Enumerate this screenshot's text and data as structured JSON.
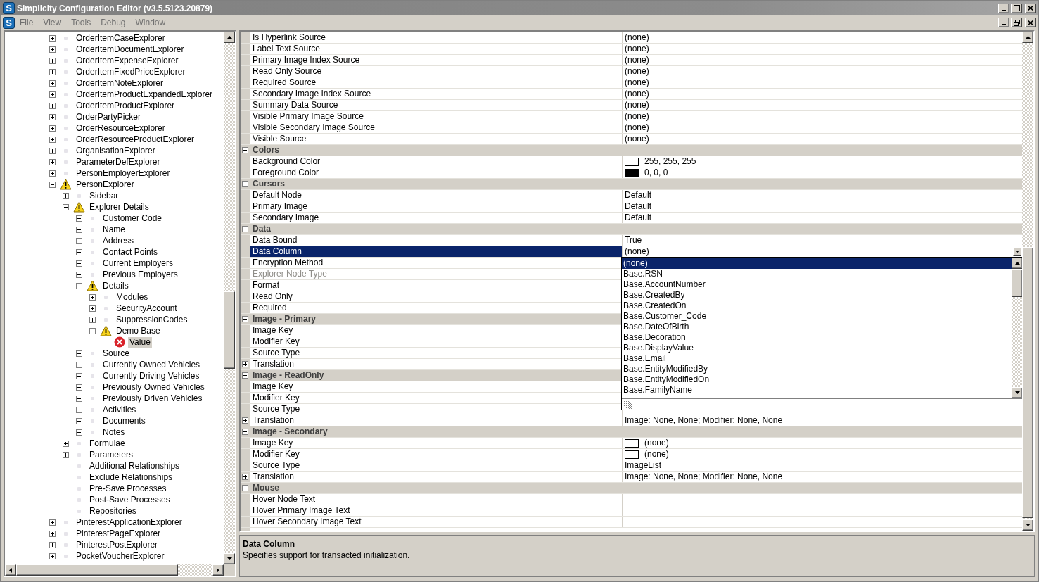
{
  "window": {
    "title": "Simplicity Configuration Editor (v3.5.5123.20879)",
    "logo": "S"
  },
  "menu": {
    "logo": "S",
    "items": [
      "File",
      "View",
      "Tools",
      "Debug",
      "Window"
    ]
  },
  "tree": {
    "nodes": [
      {
        "label": "OrderItemCaseExplorer",
        "expanded": false,
        "kind": "item",
        "selected": false
      },
      {
        "label": "OrderItemDocumentExplorer",
        "expanded": false,
        "kind": "item",
        "selected": false
      },
      {
        "label": "OrderItemExpenseExplorer",
        "expanded": false,
        "kind": "item",
        "selected": false
      },
      {
        "label": "OrderItemFixedPriceExplorer",
        "expanded": false,
        "kind": "item",
        "selected": false
      },
      {
        "label": "OrderItemNoteExplorer",
        "expanded": false,
        "kind": "item",
        "selected": false
      },
      {
        "label": "OrderItemProductExpandedExplorer",
        "expanded": false,
        "kind": "item",
        "selected": false
      },
      {
        "label": "OrderItemProductExplorer",
        "expanded": false,
        "kind": "item",
        "selected": false
      },
      {
        "label": "OrderPartyPicker",
        "expanded": false,
        "kind": "item",
        "selected": false
      },
      {
        "label": "OrderResourceExplorer",
        "expanded": false,
        "kind": "item",
        "selected": false
      },
      {
        "label": "OrderResourceProductExplorer",
        "expanded": false,
        "kind": "item",
        "selected": false
      },
      {
        "label": "OrganisationExplorer",
        "expanded": false,
        "kind": "item",
        "selected": false
      },
      {
        "label": "ParameterDefExplorer",
        "expanded": false,
        "kind": "item",
        "selected": false
      },
      {
        "label": "PersonEmployerExplorer",
        "expanded": false,
        "kind": "item",
        "selected": false
      },
      {
        "label": "PersonExplorer",
        "expanded": true,
        "kind": "warning",
        "selected": false,
        "children": [
          {
            "label": "Sidebar",
            "expanded": false,
            "kind": "item",
            "selected": false
          },
          {
            "label": "Explorer Details",
            "expanded": true,
            "kind": "warning",
            "selected": false,
            "children": [
              {
                "label": "Customer Code",
                "expanded": false,
                "kind": "item",
                "selected": false
              },
              {
                "label": "Name",
                "expanded": false,
                "kind": "item",
                "selected": false
              },
              {
                "label": "Address",
                "expanded": false,
                "kind": "item",
                "selected": false
              },
              {
                "label": "Contact Points",
                "expanded": false,
                "kind": "item",
                "selected": false
              },
              {
                "label": "Current Employers",
                "expanded": false,
                "kind": "item",
                "selected": false
              },
              {
                "label": "Previous Employers",
                "expanded": false,
                "kind": "item",
                "selected": false
              },
              {
                "label": "Details",
                "expanded": true,
                "kind": "warning",
                "selected": false,
                "children": [
                  {
                    "label": "Modules",
                    "expanded": false,
                    "kind": "item",
                    "selected": false
                  },
                  {
                    "label": "SecurityAccount",
                    "expanded": false,
                    "kind": "item",
                    "selected": false
                  },
                  {
                    "label": "SuppressionCodes",
                    "expanded": false,
                    "kind": "item",
                    "selected": false
                  },
                  {
                    "label": "Demo Base",
                    "expanded": true,
                    "kind": "warning",
                    "selected": false,
                    "children": [
                      {
                        "label": "Value",
                        "kind": "error",
                        "selected": true
                      }
                    ]
                  }
                ]
              },
              {
                "label": "Source",
                "expanded": false,
                "kind": "item",
                "selected": false
              },
              {
                "label": "Currently Owned Vehicles",
                "expanded": false,
                "kind": "item",
                "selected": false
              },
              {
                "label": "Currently Driving Vehicles",
                "expanded": false,
                "kind": "item",
                "selected": false
              },
              {
                "label": "Previously Owned Vehicles",
                "expanded": false,
                "kind": "item",
                "selected": false
              },
              {
                "label": "Previously Driven Vehicles",
                "expanded": false,
                "kind": "item",
                "selected": false
              },
              {
                "label": "Activities",
                "expanded": false,
                "kind": "item",
                "selected": false
              },
              {
                "label": "Documents",
                "expanded": false,
                "kind": "item",
                "selected": false
              },
              {
                "label": "Notes",
                "expanded": false,
                "kind": "item",
                "selected": false
              }
            ]
          },
          {
            "label": "Formulae",
            "expanded": false,
            "kind": "item",
            "selected": false
          },
          {
            "label": "Parameters",
            "expanded": false,
            "kind": "item",
            "selected": false
          },
          {
            "label": "Additional Relationships",
            "kind": "item",
            "selected": false
          },
          {
            "label": "Exclude Relationships",
            "kind": "item",
            "selected": false
          },
          {
            "label": "Pre-Save Processes",
            "kind": "item",
            "selected": false
          },
          {
            "label": "Post-Save Processes",
            "kind": "item",
            "selected": false
          },
          {
            "label": "Repositories",
            "kind": "item",
            "selected": false
          }
        ]
      },
      {
        "label": "PinterestApplicationExplorer",
        "expanded": false,
        "kind": "item",
        "selected": false
      },
      {
        "label": "PinterestPageExplorer",
        "expanded": false,
        "kind": "item",
        "selected": false
      },
      {
        "label": "PinterestPostExplorer",
        "expanded": false,
        "kind": "item",
        "selected": false
      },
      {
        "label": "PocketVoucherExplorer",
        "expanded": false,
        "kind": "item",
        "selected": false
      }
    ]
  },
  "property_grid": {
    "groups": [
      {
        "rows": [
          {
            "name": "Is Hyperlink Source",
            "value": "(none)"
          },
          {
            "name": "Label Text Source",
            "value": "(none)"
          },
          {
            "name": "Primary Image Index Source",
            "value": "(none)"
          },
          {
            "name": "Read Only Source",
            "value": "(none)"
          },
          {
            "name": "Required Source",
            "value": "(none)"
          },
          {
            "name": "Secondary Image Index Source",
            "value": "(none)"
          },
          {
            "name": "Summary Data Source",
            "value": "(none)"
          },
          {
            "name": "Visible Primary Image Source",
            "value": "(none)"
          },
          {
            "name": "Visible Secondary Image Source",
            "value": "(none)"
          },
          {
            "name": "Visible Source",
            "value": "(none)"
          }
        ]
      },
      {
        "name": "Colors",
        "expanded": true,
        "rows": [
          {
            "name": "Background Color",
            "value": "255, 255, 255",
            "color": "#ffffff"
          },
          {
            "name": "Foreground Color",
            "value": "0, 0, 0",
            "color": "#000000"
          }
        ]
      },
      {
        "name": "Cursors",
        "expanded": true,
        "rows": [
          {
            "name": "Default Node",
            "value": "Default"
          },
          {
            "name": "Primary Image",
            "value": "Default"
          },
          {
            "name": "Secondary Image",
            "value": "Default"
          }
        ]
      },
      {
        "name": "Data",
        "expanded": true,
        "rows": [
          {
            "name": "Data Bound",
            "value": "True"
          },
          {
            "name": "Data Column",
            "value": "(none)",
            "selected": true,
            "dropdown": {
              "options": [
                {
                  "label": "(none)",
                  "selected": true
                },
                {
                  "label": "Base.RSN",
                  "selected": false
                },
                {
                  "label": "Base.AccountNumber",
                  "selected": false
                },
                {
                  "label": "Base.CreatedBy",
                  "selected": false
                },
                {
                  "label": "Base.CreatedOn",
                  "selected": false
                },
                {
                  "label": "Base.Customer_Code",
                  "selected": false
                },
                {
                  "label": "Base.DateOfBirth",
                  "selected": false
                },
                {
                  "label": "Base.Decoration",
                  "selected": false
                },
                {
                  "label": "Base.DisplayValue",
                  "selected": false
                },
                {
                  "label": "Base.Email",
                  "selected": false
                },
                {
                  "label": "Base.EntityModifiedBy",
                  "selected": false
                },
                {
                  "label": "Base.EntityModifiedOn",
                  "selected": false
                },
                {
                  "label": "Base.FamilyName",
                  "selected": false
                }
              ]
            }
          },
          {
            "name": "Encryption Method"
          },
          {
            "name": "Explorer Node Type",
            "disabled": true
          },
          {
            "name": "Format"
          },
          {
            "name": "Read Only"
          },
          {
            "name": "Required"
          }
        ]
      },
      {
        "name": "Image - Primary",
        "expanded": true,
        "rows": [
          {
            "name": "Image Key"
          },
          {
            "name": "Modifier Key"
          },
          {
            "name": "Source Type"
          },
          {
            "name": "Translation",
            "expanded": false
          }
        ]
      },
      {
        "name": "Image - ReadOnly",
        "expanded": true,
        "rows": [
          {
            "name": "Image Key"
          },
          {
            "name": "Modifier Key"
          },
          {
            "name": "Source Type"
          },
          {
            "name": "Translation",
            "expanded": false,
            "value": "Image: None, None; Modifier: None, None"
          }
        ]
      },
      {
        "name": "Image - Secondary",
        "expanded": true,
        "rows": [
          {
            "name": "Image Key",
            "value": "(none)",
            "color": "#ffffff"
          },
          {
            "name": "Modifier Key",
            "value": "(none)",
            "color": "#ffffff"
          },
          {
            "name": "Source Type",
            "value": "ImageList"
          },
          {
            "name": "Translation",
            "expanded": false,
            "value": "Image: None, None; Modifier: None, None"
          }
        ]
      },
      {
        "name": "Mouse",
        "expanded": true,
        "rows": [
          {
            "name": "Hover Node Text"
          },
          {
            "name": "Hover Primary Image Text"
          },
          {
            "name": "Hover Secondary Image Text"
          }
        ]
      }
    ]
  },
  "help": {
    "title": "Data Column",
    "description": "Specifies support for transacted initialization."
  }
}
